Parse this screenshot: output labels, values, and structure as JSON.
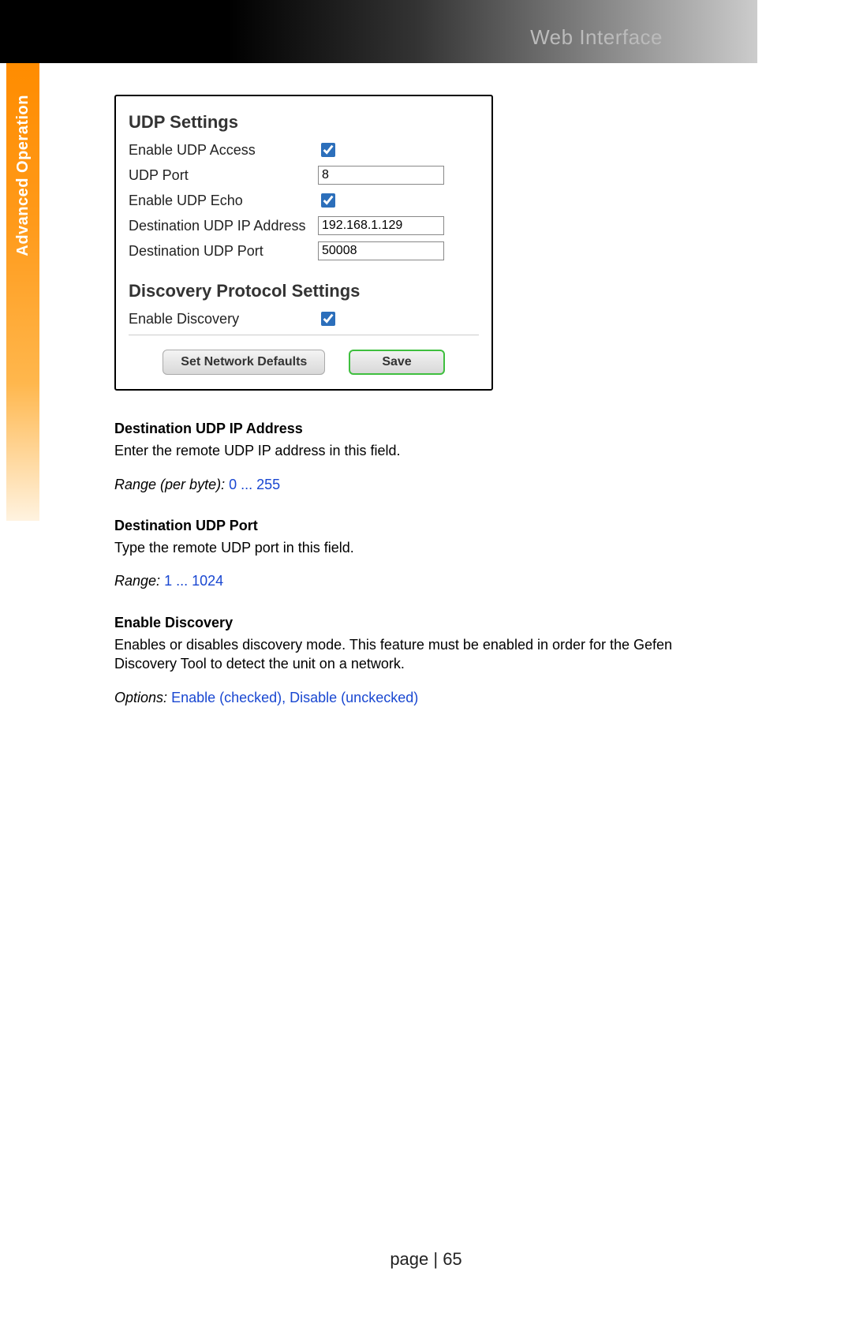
{
  "header": {
    "title": "Web Interface"
  },
  "side_tab": "Advanced Operation",
  "settings": {
    "udp": {
      "title": "UDP Settings",
      "enable_access_label": "Enable UDP Access",
      "enable_access_checked": true,
      "port_label": "UDP Port",
      "port_value": "8",
      "enable_echo_label": "Enable UDP Echo",
      "enable_echo_checked": true,
      "dest_ip_label": "Destination UDP IP Address",
      "dest_ip_value": "192.168.1.129",
      "dest_port_label": "Destination UDP Port",
      "dest_port_value": "50008"
    },
    "discovery": {
      "title": "Discovery Protocol Settings",
      "enable_label": "Enable Discovery",
      "enable_checked": true
    },
    "buttons": {
      "defaults": "Set Network Defaults",
      "save": "Save"
    }
  },
  "desc": {
    "dest_ip": {
      "heading": "Destination UDP IP Address",
      "text": "Enter the remote UDP IP address in this field.",
      "range_label": "Range (per byte):",
      "range_value": "0 ... 255"
    },
    "dest_port": {
      "heading": "Destination UDP Port",
      "text": "Type the remote UDP port in this field.",
      "range_label": "Range:",
      "range_value": "1 ... 1024"
    },
    "discovery": {
      "heading": "Enable Discovery",
      "text": "Enables or disables discovery mode. This feature must be enabled in order for the Gefen Discovery Tool to detect the unit on a network.",
      "options_label": "Options:",
      "options_value": "Enable (checked), Disable (unckecked)"
    }
  },
  "footer": {
    "page_label": "page | 65"
  }
}
